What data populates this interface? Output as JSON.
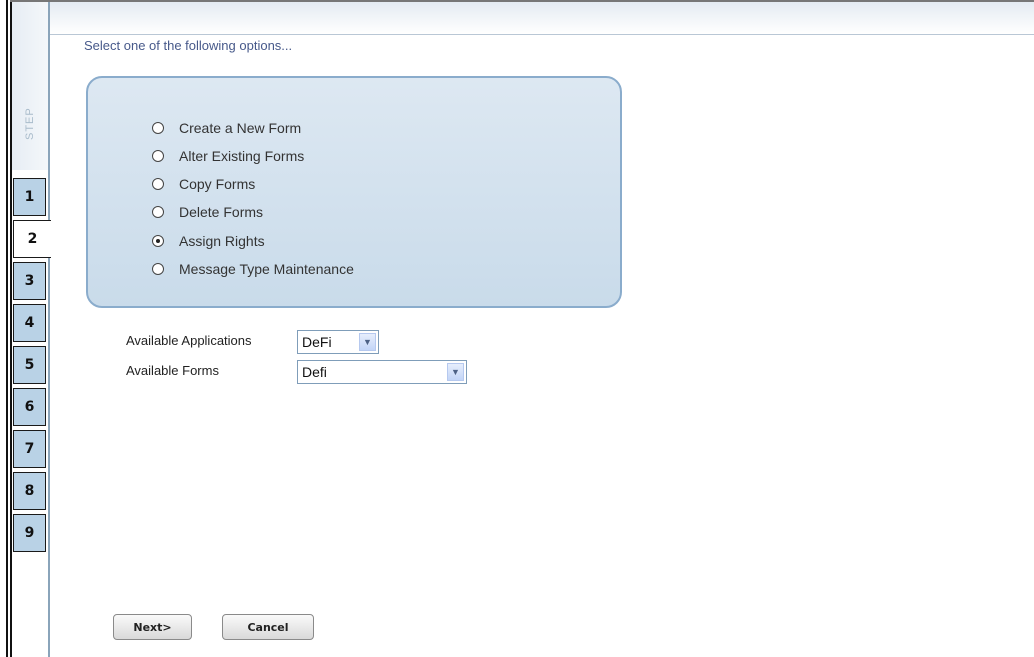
{
  "step_rail": {
    "label": "STEP",
    "steps": [
      "1",
      "2",
      "3",
      "4",
      "5",
      "6",
      "7",
      "8",
      "9"
    ],
    "active_step": "2"
  },
  "instruction": "Select one of the following options...",
  "options": [
    {
      "label": "Create a New Form",
      "selected": false
    },
    {
      "label": "Alter Existing Forms",
      "selected": false
    },
    {
      "label": "Copy Forms",
      "selected": false
    },
    {
      "label": "Delete Forms",
      "selected": false
    },
    {
      "label": "Assign Rights",
      "selected": true
    },
    {
      "label": "Message Type Maintenance",
      "selected": false
    }
  ],
  "fields": {
    "applications": {
      "label": "Available Applications",
      "value": "DeFi"
    },
    "forms": {
      "label": "Available Forms",
      "value": "Defi"
    }
  },
  "buttons": {
    "next": "Next>",
    "cancel": "Cancel"
  },
  "colors": {
    "accent_border": "#8aaccc",
    "step_tab": "#b9d2e6",
    "instruction_text": "#47598a"
  }
}
